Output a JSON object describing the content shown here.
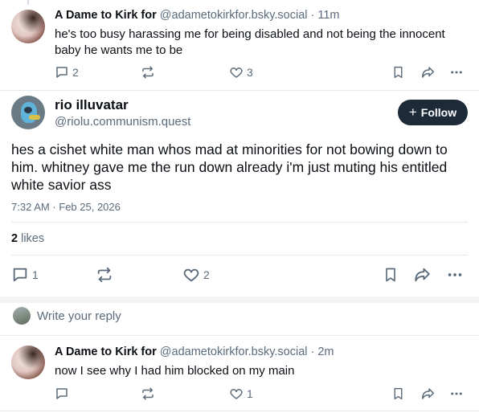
{
  "post_top": {
    "author_name": "A Dame to Kirk for",
    "handle": "@adametokirkfor.bsky.social",
    "time": "· 11m",
    "text": "he's too busy harassing me for being disabled and not being the innocent baby he wants me to be",
    "reply_count": "2",
    "repost_count": "",
    "like_count": "3"
  },
  "main_post": {
    "author_name": "rio illuvatar",
    "handle": "@riolu.communism.quest",
    "follow_label": "Follow",
    "text": "hes a cishet white man whos mad at minorities for not bowing down to him. whitney gave me the run down already i'm just muting his entitled white savior ass",
    "timestamp": "7:32 AM · Feb 25, 2026",
    "likes_count": "2",
    "likes_label": "likes",
    "reply_count": "1",
    "like_count": "2"
  },
  "reply_composer": {
    "placeholder": "Write your reply"
  },
  "post_bottom": {
    "author_name": "A Dame to Kirk for",
    "handle": "@adametokirkfor.bsky.social",
    "time": "· 2m",
    "text": "now I see why I had him blocked on my main",
    "reply_count": "",
    "like_count": "1"
  },
  "icons": {
    "reply": "speech-bubble-icon",
    "repost": "repost-arrows-icon",
    "like": "heart-icon",
    "bookmark": "bookmark-icon",
    "share": "share-arrow-icon",
    "more": "ellipsis-icon"
  }
}
